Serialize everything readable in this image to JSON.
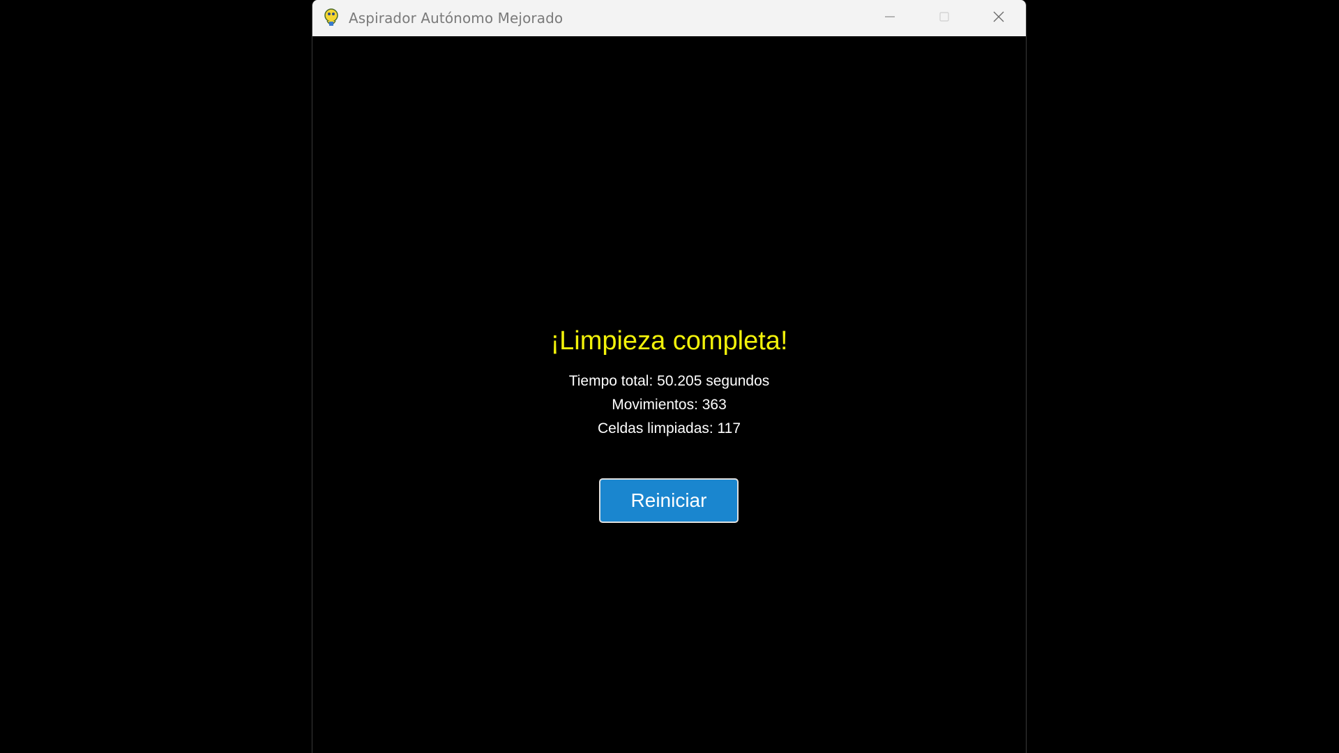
{
  "window": {
    "title": "Aspirador Autónomo Mejorado",
    "app_icon": "pygame-snake-icon",
    "controls": {
      "minimize": "minimize-icon",
      "maximize": "maximize-icon",
      "close": "close-icon"
    }
  },
  "content": {
    "headline": "¡Limpieza completa!",
    "stats": {
      "time": "Tiempo total: 50.205 segundos",
      "moves": "Movimientos: 363",
      "cells": "Celdas limpiadas: 117"
    },
    "restart_label": "Reiniciar"
  },
  "colors": {
    "background": "#000000",
    "headline": "#f2f20a",
    "stats_text": "#ffffff",
    "button": "#1a86cf",
    "button_border": "#e0e0e0",
    "titlebar": "#f3f3f3"
  }
}
